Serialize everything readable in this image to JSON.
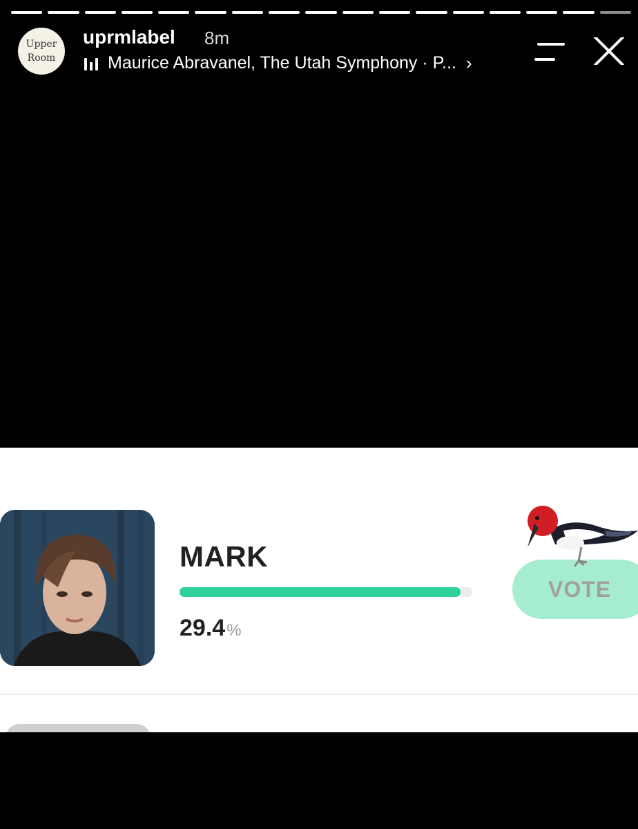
{
  "story": {
    "segments": 17,
    "active_segments": 16,
    "avatar_line1": "Upper",
    "avatar_line2": "Room",
    "username": "uprmlabel",
    "time": "8m",
    "music": "Maurice Abravanel, The Utah Symphony · P...",
    "chevron": "›"
  },
  "poll": {
    "name": "MARK",
    "percent_value": "29.4",
    "percent_unit": "%",
    "fill_fraction": 0.96,
    "vote_label": "VOTE",
    "bar_color": "#2ed19a",
    "vote_color": "#a6ecd0"
  },
  "icons": {
    "menu": "filter-lines-icon",
    "close": "close-icon",
    "music": "audio-bars-icon",
    "sticker": "woodpecker-sticker"
  }
}
